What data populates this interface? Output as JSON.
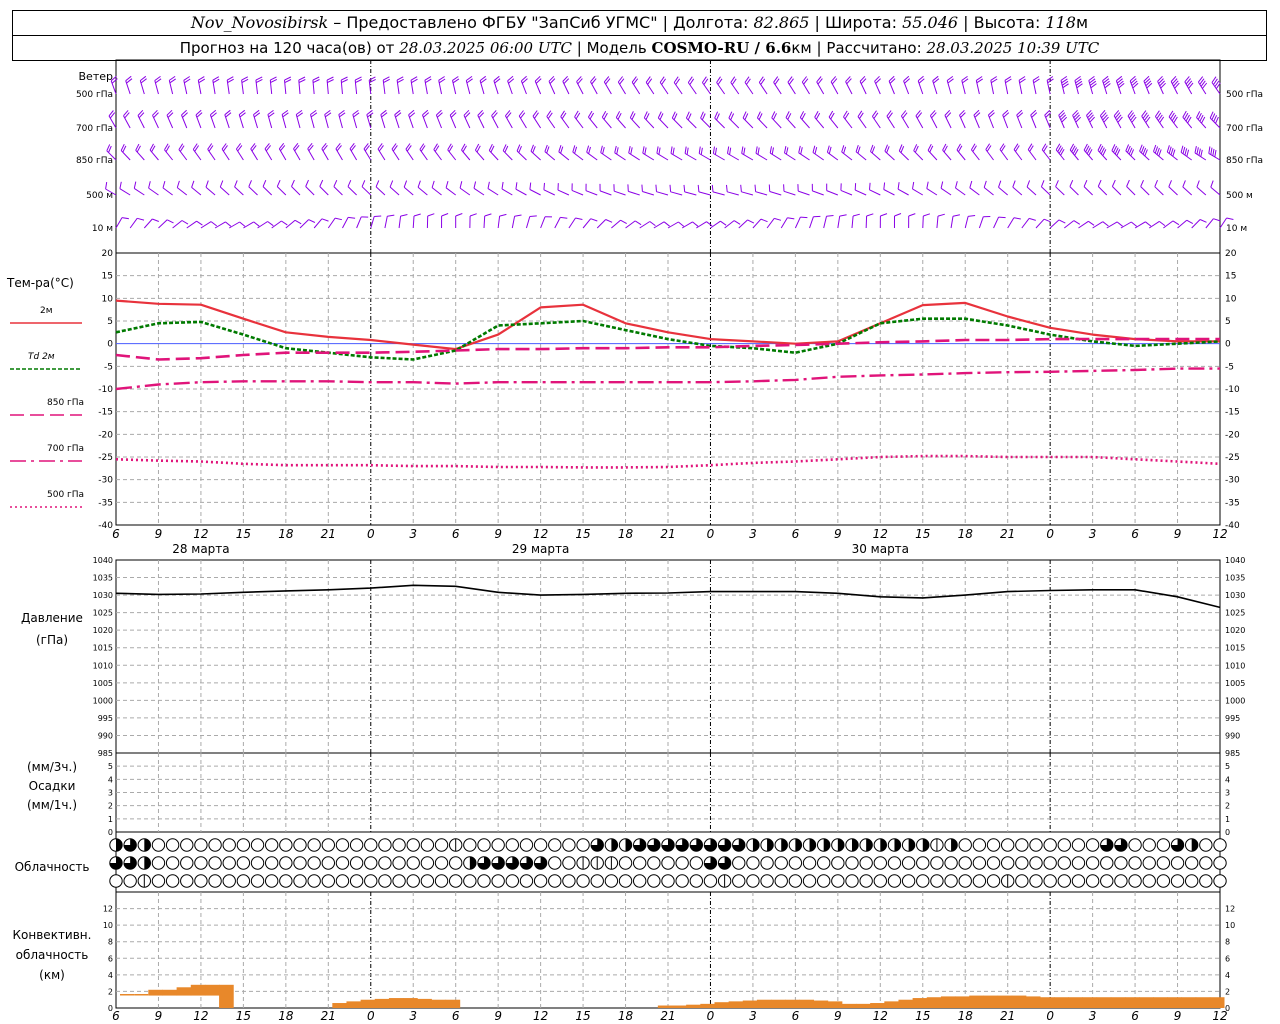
{
  "header": {
    "station": "Nov_Novosibirsk",
    "provided": "– Предоставлено ФГБУ \"ЗапСиб УГМС\" |",
    "lon_label": "Долгота:",
    "lon_value": "82.865",
    "lat_label": "| Широта:",
    "lat_value": "55.046",
    "alt_label": "| Высота:",
    "alt_value": "118",
    "alt_unit": "м",
    "forecast_label": "Прогноз на 120 часа(ов) от",
    "forecast_start": "28.03.2025 06:00 UTC",
    "model_label": "| Модель",
    "model_name": "COSMO-RU / 6.6",
    "model_unit": "км",
    "calc_label": "| Рассчитано:",
    "calc_time": "28.03.2025 10:39 UTC"
  },
  "labels": {
    "wind": "Ветер",
    "temp": "Тем-ра(°C)",
    "pressure": "Давление",
    "pressure_unit": "(гПа)",
    "precip_unit3": "(мм/3ч.)",
    "precip": "Осадки",
    "precip_unit1": "(мм/1ч.)",
    "cloud": "Облачность",
    "conv1": "Конвективн.",
    "conv2": "облачность",
    "conv_unit": "(км)"
  },
  "wind_levels": [
    "500 гПа",
    "700 гПа",
    "850 гПа",
    "500 м",
    "10 м"
  ],
  "temp_legend": [
    "2м",
    "Td 2м",
    "850 гПа",
    "700 гПа",
    "500 гПа"
  ],
  "dates": [
    "28 марта",
    "29 марта",
    "30 марта"
  ],
  "time_ticks": [
    "6",
    "9",
    "12",
    "15",
    "18",
    "21",
    "0",
    "3",
    "6",
    "9",
    "12",
    "15",
    "18",
    "21",
    "0",
    "3",
    "6",
    "9",
    "12",
    "15",
    "18",
    "21",
    "0",
    "3",
    "6",
    "9",
    "12"
  ],
  "colors": {
    "t2m": "#e8323c",
    "td2m": "#007a00",
    "t850": "#e0147a",
    "t700": "#e0147a",
    "t500": "#e0147a",
    "wind": "#8a00e6",
    "pressure": "#000000",
    "conv": "#e8882a"
  },
  "chart_data": [
    {
      "type": "line",
      "title": "Тем-ра(°C)",
      "x": [
        0,
        3,
        6,
        9,
        12,
        15,
        18,
        21,
        24,
        27,
        30,
        33,
        36,
        39,
        42,
        45,
        48,
        51,
        54,
        57,
        60,
        63,
        66,
        69,
        72,
        75,
        78
      ],
      "ylim": [
        -40,
        20
      ],
      "yticks": [
        20,
        15,
        10,
        5,
        0,
        -5,
        -10,
        -15,
        -20,
        -25,
        -30,
        -35,
        -40
      ],
      "series": [
        {
          "name": "2м",
          "values": [
            9.5,
            8.8,
            8.6,
            5.5,
            2.5,
            1.5,
            0.8,
            -0.2,
            -1.2,
            2.0,
            8.0,
            8.6,
            4.5,
            2.5,
            1.0,
            0.5,
            0.0,
            0.5,
            4.5,
            8.5,
            9.0,
            6.0,
            3.5,
            2.0,
            1.0,
            0.5,
            0.5
          ]
        },
        {
          "name": "Td 2м",
          "values": [
            2.5,
            4.5,
            4.8,
            2.0,
            -1.0,
            -2.0,
            -3.0,
            -3.5,
            -1.5,
            4.0,
            4.5,
            5.0,
            3.0,
            1.0,
            -0.5,
            -1.0,
            -2.0,
            0.0,
            4.5,
            5.5,
            5.5,
            4.0,
            2.0,
            0.5,
            -0.5,
            0.0,
            0.5
          ]
        },
        {
          "name": "850 гПа",
          "values": [
            -2.5,
            -3.5,
            -3.2,
            -2.5,
            -2.0,
            -2.0,
            -2.0,
            -1.8,
            -1.5,
            -1.2,
            -1.2,
            -1.0,
            -1.0,
            -0.8,
            -0.8,
            -0.5,
            -0.3,
            0.0,
            0.3,
            0.5,
            0.8,
            0.8,
            1.0,
            1.0,
            1.0,
            1.0,
            1.0
          ]
        },
        {
          "name": "700 гПа",
          "values": [
            -10.0,
            -9.0,
            -8.5,
            -8.3,
            -8.3,
            -8.3,
            -8.5,
            -8.5,
            -8.8,
            -8.5,
            -8.5,
            -8.5,
            -8.5,
            -8.5,
            -8.5,
            -8.3,
            -8.0,
            -7.3,
            -7.0,
            -6.8,
            -6.5,
            -6.3,
            -6.2,
            -6.0,
            -5.8,
            -5.5,
            -5.5
          ]
        },
        {
          "name": "500 гПа",
          "values": [
            -25.5,
            -25.8,
            -26.0,
            -26.5,
            -26.8,
            -26.8,
            -26.8,
            -27.0,
            -27.0,
            -27.2,
            -27.2,
            -27.3,
            -27.3,
            -27.2,
            -26.8,
            -26.3,
            -26.0,
            -25.5,
            -25.0,
            -24.8,
            -24.8,
            -25.0,
            -25.0,
            -25.0,
            -25.5,
            -26.0,
            -26.5
          ]
        }
      ]
    },
    {
      "type": "line",
      "title": "Давление",
      "ylabel": "(гПа)",
      "x": [
        0,
        3,
        6,
        9,
        12,
        15,
        18,
        21,
        24,
        27,
        30,
        33,
        36,
        39,
        42,
        45,
        48,
        51,
        54,
        57,
        60,
        63,
        66,
        69,
        72,
        75,
        78
      ],
      "ylim": [
        985,
        1040
      ],
      "yticks": [
        1040,
        1035,
        1030,
        1025,
        1020,
        1015,
        1010,
        1005,
        1000,
        995,
        990,
        985
      ],
      "series": [
        {
          "name": "Давление",
          "values": [
            1030.5,
            1030.2,
            1030.3,
            1030.8,
            1031.2,
            1031.5,
            1032.0,
            1032.8,
            1032.5,
            1030.8,
            1030.0,
            1030.2,
            1030.5,
            1030.6,
            1031.0,
            1031.0,
            1031.0,
            1030.5,
            1029.5,
            1029.2,
            1030.0,
            1031.0,
            1031.3,
            1031.5,
            1031.5,
            1029.5,
            1026.5
          ]
        }
      ]
    },
    {
      "type": "bar",
      "title": "Осадки",
      "ylabel": "(мм/3ч.) (мм/1ч.)",
      "ylim": [
        0,
        5
      ],
      "yticks": [
        5,
        4,
        3,
        2,
        1,
        0
      ],
      "values": []
    },
    {
      "type": "area",
      "title": "Конвективн. облачность",
      "ylabel": "(км)",
      "x": [
        0,
        1,
        2,
        3,
        4,
        5,
        6,
        7,
        8,
        15,
        16,
        17,
        18,
        19,
        20,
        21,
        22,
        23,
        24,
        38,
        39,
        40,
        41,
        42,
        43,
        44,
        45,
        46,
        47,
        48,
        49,
        50,
        51,
        52,
        53,
        54,
        55,
        56,
        57,
        58,
        59,
        60,
        61,
        62,
        63,
        64,
        65,
        66,
        67,
        68,
        69,
        70,
        71,
        72,
        73,
        74,
        75,
        76,
        77,
        78
      ],
      "ylim": [
        0,
        14
      ],
      "yticks": [
        12,
        10,
        8,
        6,
        4,
        2,
        0
      ],
      "series": [
        {
          "name": "base",
          "values": [
            1.5,
            1.5,
            1.5,
            1.5,
            1.5,
            1.5,
            1.5,
            0,
            0,
            0,
            0,
            0,
            0,
            0,
            0,
            0,
            0,
            0,
            0,
            0,
            0,
            0,
            0,
            0,
            0,
            0,
            0,
            0,
            0,
            0,
            0,
            0,
            0,
            0,
            0,
            0,
            0,
            0,
            0,
            0,
            0,
            0,
            0,
            0,
            0,
            0,
            0,
            0,
            0,
            0,
            0,
            0,
            0,
            0,
            0,
            0,
            0,
            0,
            0,
            0
          ]
        },
        {
          "name": "top",
          "values": [
            1.6,
            1.6,
            2.2,
            2.2,
            2.5,
            2.8,
            2.8,
            2.8,
            2.8,
            0.6,
            0.8,
            1.0,
            1.1,
            1.2,
            1.2,
            1.1,
            1.0,
            1.0,
            0.9,
            0.3,
            0.3,
            0.4,
            0.5,
            0.7,
            0.8,
            0.9,
            1.0,
            1.0,
            1.0,
            1.0,
            0.9,
            0.8,
            0.5,
            0.5,
            0.6,
            0.8,
            1.0,
            1.2,
            1.3,
            1.4,
            1.4,
            1.5,
            1.5,
            1.5,
            1.5,
            1.4,
            1.3,
            1.3,
            1.3,
            1.3,
            1.3,
            1.3,
            1.3,
            1.3,
            1.3,
            1.3,
            1.3,
            1.3,
            1.3,
            1.3
          ]
        }
      ]
    },
    {
      "type": "table",
      "title": "Облачность",
      "rows": [
        [
          2,
          3,
          1,
          2,
          0,
          0,
          0,
          0,
          0,
          0,
          0,
          0,
          0,
          0,
          0,
          0,
          0,
          0,
          0,
          0,
          0,
          0,
          0,
          0,
          0,
          0,
          0,
          0,
          0,
          0,
          0,
          0,
          0,
          0,
          0,
          0,
          0,
          0,
          0,
          0,
          0,
          0,
          0,
          0,
          0,
          1,
          0,
          0,
          0,
          0,
          0,
          0,
          0,
          0,
          0,
          0,
          0,
          0,
          0,
          0,
          0,
          0,
          0,
          0,
          3,
          2,
          2,
          3,
          2,
          3,
          3,
          3,
          3,
          3,
          3,
          3,
          3,
          3,
          3,
          3,
          3,
          3,
          3,
          3,
          3,
          3,
          2,
          2,
          2,
          2,
          2,
          2,
          2,
          2,
          2,
          2,
          2,
          2,
          2,
          2,
          2,
          2,
          2,
          2,
          2,
          2,
          2,
          2,
          2,
          2,
          1,
          1,
          2,
          1,
          0,
          0,
          0,
          0,
          0,
          0,
          0,
          0,
          0,
          0,
          0,
          0,
          0,
          0,
          0,
          0,
          0,
          0,
          3,
          3,
          3,
          3,
          2,
          0,
          0,
          0,
          0,
          0,
          2,
          3,
          3,
          2,
          0,
          0,
          0,
          0,
          0
        ],
        [
          3,
          3,
          2,
          2,
          0,
          0,
          0,
          0,
          0,
          0,
          0,
          0,
          0,
          0,
          0,
          0,
          0,
          0,
          0,
          0,
          0,
          0,
          0,
          0,
          0,
          0,
          0,
          0,
          0,
          0,
          0,
          0,
          0,
          0,
          0,
          0,
          0,
          0,
          0,
          0,
          0,
          0,
          0,
          0,
          0,
          0,
          0,
          2,
          3,
          3,
          3,
          3,
          3,
          3,
          3,
          3,
          3,
          3,
          3,
          0,
          0,
          0,
          0,
          1,
          1,
          1,
          1,
          0,
          0,
          0,
          0,
          0,
          0,
          0,
          0,
          0,
          0,
          0,
          0,
          3,
          3,
          3,
          3,
          0,
          0,
          0,
          0,
          0,
          0,
          0,
          0,
          0,
          0,
          0,
          0,
          0,
          0,
          0,
          0,
          0,
          0,
          0,
          0,
          0,
          0,
          0,
          0,
          0,
          0,
          0,
          0,
          0,
          0,
          0,
          0,
          0,
          0,
          0,
          0,
          0,
          0,
          0,
          0,
          0,
          0,
          0,
          0,
          0,
          0,
          0,
          0,
          0,
          0,
          0,
          0,
          0,
          0,
          0,
          0,
          0,
          0,
          0,
          0,
          0,
          0,
          0,
          0,
          0,
          0,
          0,
          0
        ],
        [
          0,
          0,
          2,
          1,
          1,
          0,
          0,
          0,
          0,
          0,
          0,
          0,
          0,
          0,
          0,
          0,
          0,
          0,
          0,
          0,
          0,
          0,
          0,
          0,
          0,
          0,
          0,
          0,
          0,
          0,
          0,
          0,
          0,
          0,
          0,
          0,
          0,
          0,
          0,
          0,
          0,
          0,
          0,
          0,
          0,
          0,
          0,
          0,
          0,
          0,
          0,
          0,
          0,
          0,
          0,
          0,
          0,
          0,
          0,
          0,
          0,
          0,
          0,
          0,
          0,
          0,
          0,
          0,
          0,
          0,
          0,
          0,
          0,
          0,
          0,
          0,
          0,
          0,
          0,
          0,
          0,
          0,
          1,
          1,
          0,
          0,
          0,
          0,
          0,
          0,
          0,
          0,
          0,
          0,
          0,
          0,
          0,
          0,
          0,
          0,
          0,
          0,
          0,
          0,
          0,
          0,
          0,
          0,
          0,
          0,
          0,
          0,
          0,
          0,
          0,
          0,
          0,
          0,
          0,
          0,
          0,
          1,
          1,
          0,
          0,
          0,
          0,
          0,
          0,
          0,
          0,
          0,
          0,
          0,
          0,
          0,
          0,
          0,
          0,
          0,
          0,
          0,
          0,
          0,
          0,
          0,
          0,
          0,
          0,
          0,
          0,
          0,
          0
        ]
      ]
    }
  ]
}
